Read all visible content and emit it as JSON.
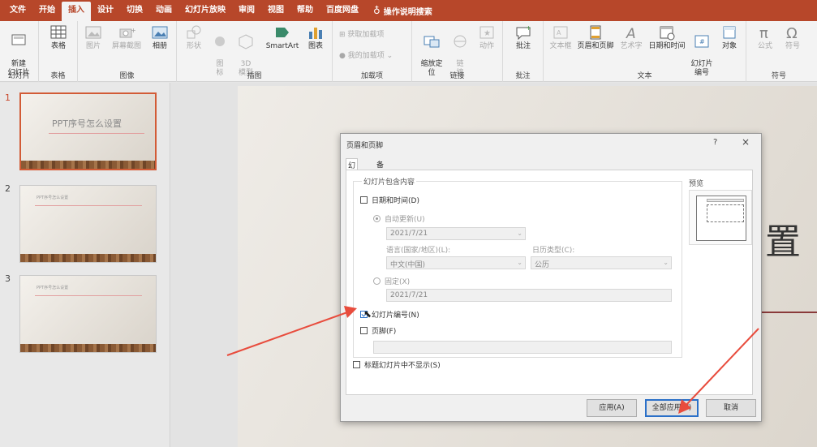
{
  "menu": {
    "tabs": [
      "文件",
      "开始",
      "插入",
      "设计",
      "切换",
      "动画",
      "幻灯片放映",
      "审阅",
      "视图",
      "帮助",
      "百度网盘"
    ],
    "active_index": 2,
    "tell_me": "操作说明搜索"
  },
  "ribbon": {
    "groups": {
      "slides": "幻灯片",
      "tables": "表格",
      "images": "图像",
      "illustrations": "插图",
      "addins": "加载项",
      "links": "链接",
      "comments": "批注",
      "text": "文本",
      "symbols": "符号"
    },
    "buttons": {
      "new_slide": "新建\n幻灯片",
      "table": "表格",
      "pictures": "图片",
      "screenshot": "屏幕截图",
      "album": "相册",
      "shapes": "形状",
      "icons": "图\n标",
      "model3d": "3D\n模型",
      "smartart": "SmartArt",
      "chart": "图表",
      "get_addins": "获取加载项",
      "my_addins": "我的加载项",
      "zoom": "缩放定\n位",
      "link": "链\n接",
      "action": "动作",
      "comment": "批注",
      "textbox": "文本框",
      "header_footer": "页眉和页脚",
      "wordart": "艺术字",
      "datetime": "日期和时间",
      "slide_number": "幻灯片\n编号",
      "object": "对象",
      "equation": "公式",
      "symbol": "符号"
    }
  },
  "thumbnails": [
    {
      "num": "1",
      "title": "PPT序号怎么设置"
    },
    {
      "num": "2",
      "title": "PPT序号怎么设置"
    },
    {
      "num": "3",
      "title": "PPT序号怎么设置"
    }
  ],
  "slide": {
    "visible_text": "置"
  },
  "dialog": {
    "title": "页眉和页脚",
    "help": "?",
    "close": "×",
    "tabs": [
      "幻灯片",
      "备注和讲义"
    ],
    "group_legend": "幻灯片包含内容",
    "date_time_label": "日期和时间(D)",
    "auto_update_label": "自动更新(U)",
    "auto_update_value": "2021/7/21",
    "language_label": "语言(国家/地区)(L):",
    "language_value": "中文(中国)",
    "calendar_label": "日历类型(C):",
    "calendar_value": "公历",
    "fixed_label": "固定(X)",
    "fixed_value": "2021/7/21",
    "slide_number_label": "幻灯片编号(N)",
    "footer_label": "页脚(F)",
    "footer_value": "",
    "no_title_label": "标题幻灯片中不显示(S)",
    "preview_label": "预览",
    "apply_button": "应用(A)",
    "apply_all_button": "全部应用(Y)",
    "cancel_button": "取消"
  },
  "colors": {
    "accent": "#b7472a",
    "annotation_arrow": "#e84c3d"
  }
}
